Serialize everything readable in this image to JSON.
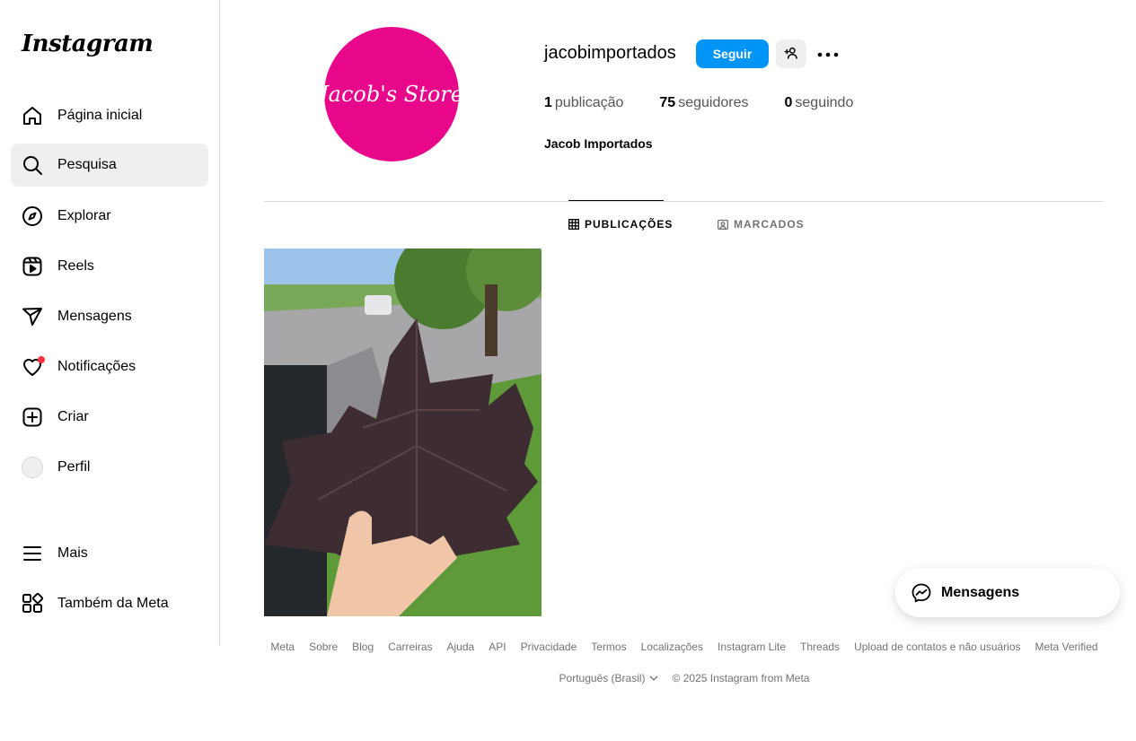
{
  "sidebar": {
    "logo": "Instagram",
    "items": [
      {
        "label": "Página inicial",
        "icon": "home-icon"
      },
      {
        "label": "Pesquisa",
        "icon": "search-icon"
      },
      {
        "label": "Explorar",
        "icon": "compass-icon"
      },
      {
        "label": "Reels",
        "icon": "reels-icon"
      },
      {
        "label": "Mensagens",
        "icon": "direct-message-icon"
      },
      {
        "label": "Notificações",
        "icon": "heart-icon"
      },
      {
        "label": "Criar",
        "icon": "create-plus-icon"
      },
      {
        "label": "Perfil",
        "icon": "profile-avatar"
      }
    ],
    "more": {
      "label": "Mais",
      "icon": "menu-icon"
    },
    "meta": {
      "label": "Também da Meta",
      "icon": "apps-icon"
    }
  },
  "profile": {
    "avatar_text": "Jacob's Store",
    "avatar_color": "#e8068b",
    "username": "jacobimportados",
    "follow_label": "Seguir",
    "stats": [
      {
        "count": "1",
        "label": "publicação"
      },
      {
        "count": "75",
        "label": "seguidores"
      },
      {
        "count": "0",
        "label": "seguindo"
      }
    ],
    "full_name": "Jacob Importados"
  },
  "tabs": [
    {
      "label": "PUBLICAÇÕES",
      "icon": "grid-icon",
      "active": true
    },
    {
      "label": "MARCADOS",
      "icon": "tagged-icon",
      "active": false
    }
  ],
  "footer": {
    "links": [
      "Meta",
      "Sobre",
      "Blog",
      "Carreiras",
      "Ajuda",
      "API",
      "Privacidade",
      "Termos",
      "Localizações",
      "Instagram Lite",
      "Threads",
      "Upload de contatos e não usuários",
      "Meta Verified"
    ],
    "language": "Português (Brasil)",
    "copyright": "© 2025 Instagram from Meta"
  },
  "messages_pill": {
    "label": "Mensagens",
    "icon": "messenger-icon"
  },
  "colors": {
    "accent": "#0095f6",
    "notification": "#ff3040"
  }
}
